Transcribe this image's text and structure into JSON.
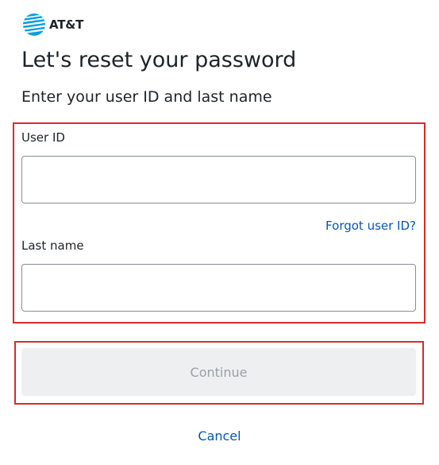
{
  "brand": {
    "logo_text": "AT&T",
    "logo_color": "#009fdb"
  },
  "header": {
    "title": "Let's reset your password",
    "subtitle": "Enter your user ID and last name"
  },
  "form": {
    "user_id": {
      "label": "User ID",
      "value": "",
      "placeholder": ""
    },
    "forgot_link": "Forgot user ID?",
    "last_name": {
      "label": "Last name",
      "value": "",
      "placeholder": ""
    }
  },
  "actions": {
    "continue_label": "Continue",
    "continue_state": "disabled",
    "cancel_label": "Cancel"
  },
  "colors": {
    "link": "#0057b8",
    "highlight_border": "#d92b2b",
    "disabled_button_bg": "#eeeff0",
    "disabled_button_text": "#9aa0a6"
  }
}
